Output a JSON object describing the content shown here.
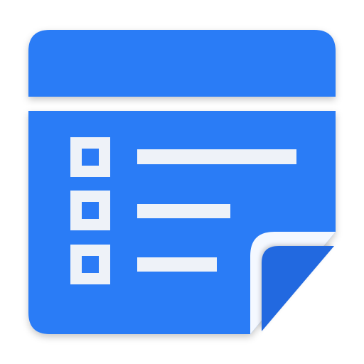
{
  "app_icon": {
    "icon": "checklist-note-icon",
    "colors": {
      "accent": "#2979ff",
      "header": "#2b7bf6",
      "fold": "#2469e0",
      "checkbox_fill": "#eef2f8",
      "line": "#eef2f8",
      "background": "#ffffff"
    },
    "checklist": {
      "items": [
        {
          "checkbox": "square-checkbox-icon",
          "line": "text-line-long"
        },
        {
          "checkbox": "square-checkbox-icon",
          "line": "text-line-medium"
        },
        {
          "checkbox": "square-checkbox-icon",
          "line": "text-line-short"
        }
      ]
    },
    "corner": "page-curl-icon"
  }
}
